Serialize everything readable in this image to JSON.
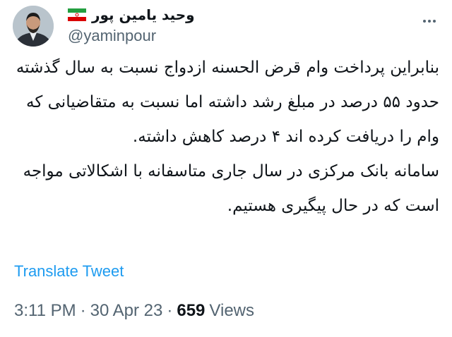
{
  "author": {
    "display_name": "وحید یامین پور",
    "handle": "@yaminpour",
    "avatar": "profile-photo",
    "flag": "iran-flag-icon"
  },
  "tweet": {
    "paragraph_1": "بنابراین پرداخت وام قرض الحسنه ازدواج نسبت به سال گذشته حدود ۵۵ درصد در مبلغ رشد داشته اما نسبت به متقاضیانی که وام را دریافت کرده اند ۴ درصد کاهش داشته.",
    "paragraph_2": "سامانه بانک مرکزی در سال جاری متاسفانه با اشکالاتی مواجه است که در حال پیگیری هستیم."
  },
  "translate_label": "Translate Tweet",
  "meta": {
    "time": "3:11 PM",
    "separator": "·",
    "date": "30 Apr 23",
    "views_count": "659",
    "views_label": "Views"
  },
  "colors": {
    "accent": "#1d9bf0",
    "secondary_text": "#536471",
    "primary_text": "#0f1419"
  }
}
